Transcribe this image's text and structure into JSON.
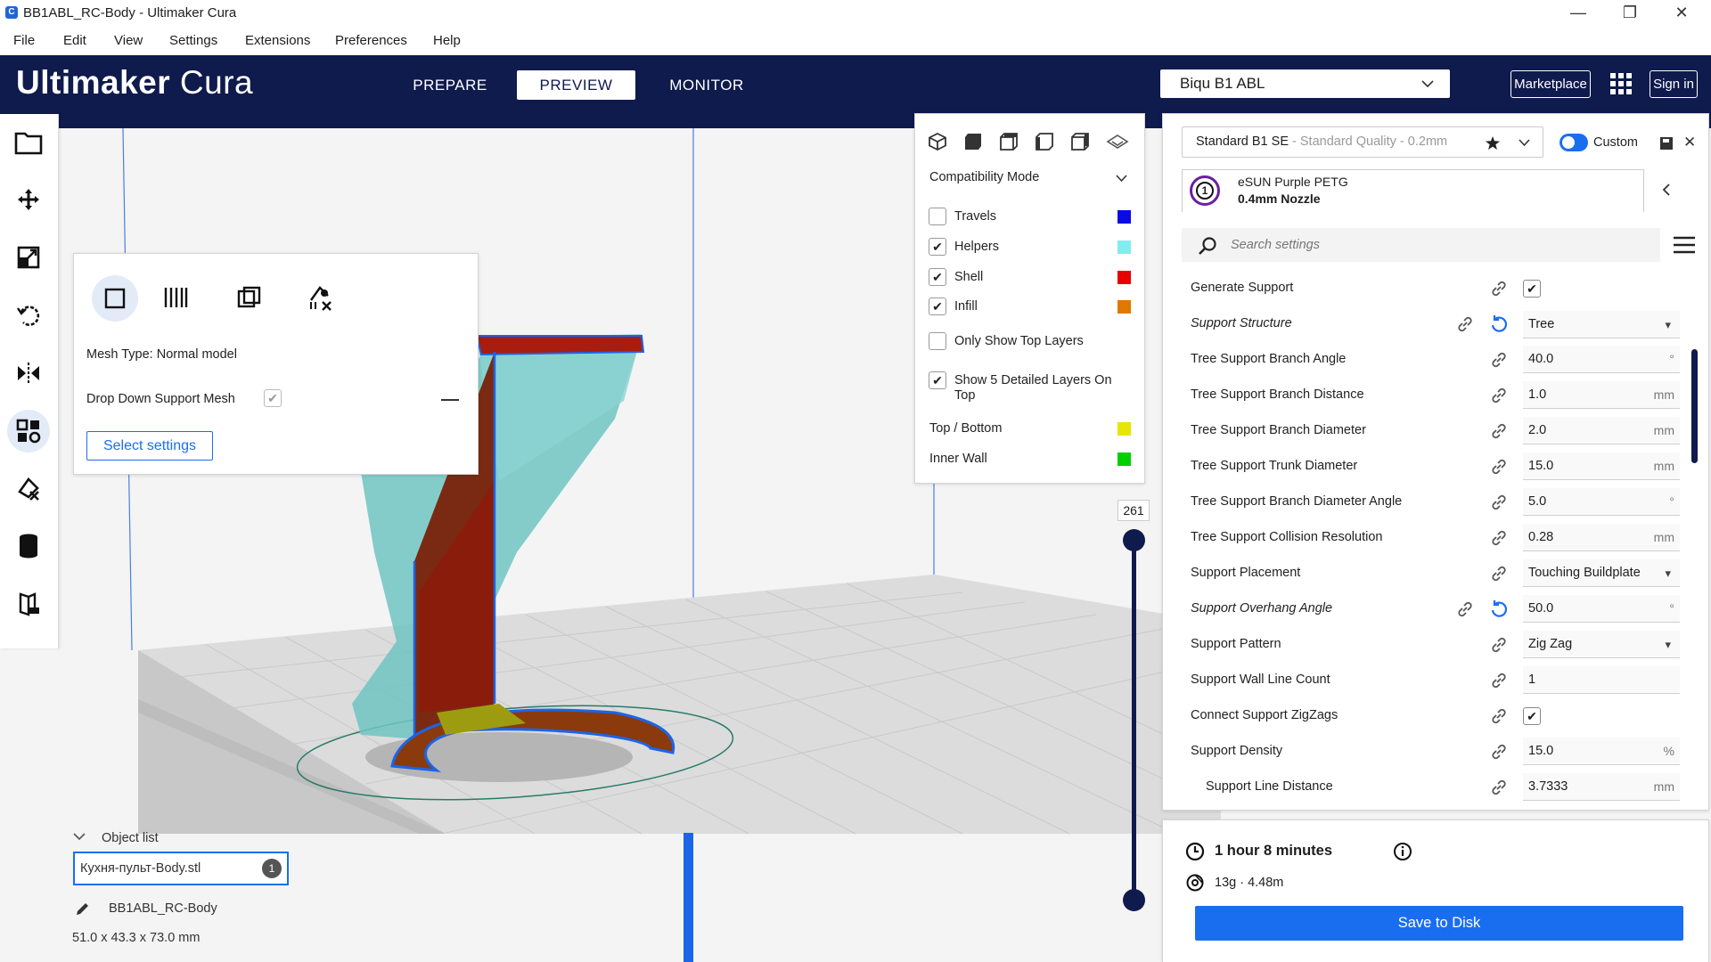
{
  "window": {
    "title": "BB1ABL_RC-Body - Ultimaker Cura",
    "app_icon_letter": "C",
    "minimize": "—",
    "maximize": "❐",
    "close": "✕"
  },
  "menu": [
    "File",
    "Edit",
    "View",
    "Settings",
    "Extensions",
    "Preferences",
    "Help"
  ],
  "header": {
    "logo_main": "Ultimaker",
    "logo_sub": "Cura",
    "stages": [
      "PREPARE",
      "PREVIEW",
      "MONITOR"
    ],
    "active_stage": "PREVIEW",
    "printer": "Biqu B1 ABL",
    "marketplace": "Marketplace",
    "sign_in": "Sign in"
  },
  "per_model_panel": {
    "mesh_type": "Mesh Type: Normal model",
    "drop_down_label": "Drop Down Support Mesh",
    "drop_down_checked": true,
    "select_settings": "Select settings"
  },
  "view_panel": {
    "mode": "Compatibility Mode",
    "items": [
      {
        "label": "Travels",
        "checked": false,
        "color": "#0a0ae6"
      },
      {
        "label": "Helpers",
        "checked": true,
        "color": "#82ecf0"
      },
      {
        "label": "Shell",
        "checked": true,
        "color": "#e60000"
      },
      {
        "label": "Infill",
        "checked": true,
        "color": "#e07800"
      }
    ],
    "only_top": "Only Show Top Layers",
    "show_detailed": "Show 5 Detailed Layers On Top",
    "legend": [
      {
        "label": "Top / Bottom",
        "color": "#e6e600"
      },
      {
        "label": "Inner Wall",
        "color": "#00d000"
      }
    ]
  },
  "layer_slider": {
    "value": "261"
  },
  "print_settings": {
    "profile": "Standard B1 SE",
    "quality": "- Standard Quality - 0.2mm",
    "custom_label": "Custom",
    "material": "eSUN Purple PETG",
    "nozzle": "0.4mm Nozzle",
    "extruder_number": "1",
    "search_placeholder": "Search settings",
    "settings": [
      {
        "label": "Generate Support",
        "type": "check",
        "value": "✔"
      },
      {
        "label": "Support Structure",
        "type": "select",
        "value": "Tree",
        "italic": true
      },
      {
        "label": "Tree Support Branch Angle",
        "type": "num",
        "value": "40.0",
        "unit": "°"
      },
      {
        "label": "Tree Support Branch Distance",
        "type": "num",
        "value": "1.0",
        "unit": "mm"
      },
      {
        "label": "Tree Support Branch Diameter",
        "type": "num",
        "value": "2.0",
        "unit": "mm"
      },
      {
        "label": "Tree Support Trunk Diameter",
        "type": "num",
        "value": "15.0",
        "unit": "mm"
      },
      {
        "label": "Tree Support Branch Diameter Angle",
        "type": "num",
        "value": "5.0",
        "unit": "°"
      },
      {
        "label": "Tree Support Collision Resolution",
        "type": "num",
        "value": "0.28",
        "unit": "mm"
      },
      {
        "label": "Support Placement",
        "type": "select",
        "value": "Touching Buildplate"
      },
      {
        "label": "Support Overhang Angle",
        "type": "num",
        "value": "50.0",
        "unit": "°",
        "italic": true
      },
      {
        "label": "Support Pattern",
        "type": "select",
        "value": "Zig Zag"
      },
      {
        "label": "Support Wall Line Count",
        "type": "num",
        "value": "1",
        "unit": ""
      },
      {
        "label": "Connect Support ZigZags",
        "type": "check",
        "value": "✔"
      },
      {
        "label": "Support Density",
        "type": "num",
        "value": "15.0",
        "unit": "%"
      },
      {
        "label": "Support Line Distance",
        "type": "num",
        "value": "3.7333",
        "unit": "mm"
      }
    ]
  },
  "job": {
    "time": "1 hour 8 minutes",
    "material": "13g · 4.48m",
    "save": "Save to Disk"
  },
  "object_list": {
    "title": "Object list",
    "file": "Кухня-пульт-Body.stl",
    "count": "1",
    "job_name": "BB1ABL_RC-Body",
    "dims": "51.0 x 43.3 x 73.0 mm"
  },
  "colors": {
    "header": "#0f1a4d",
    "accent": "#196ef0",
    "slider": "#0f1a4d"
  }
}
